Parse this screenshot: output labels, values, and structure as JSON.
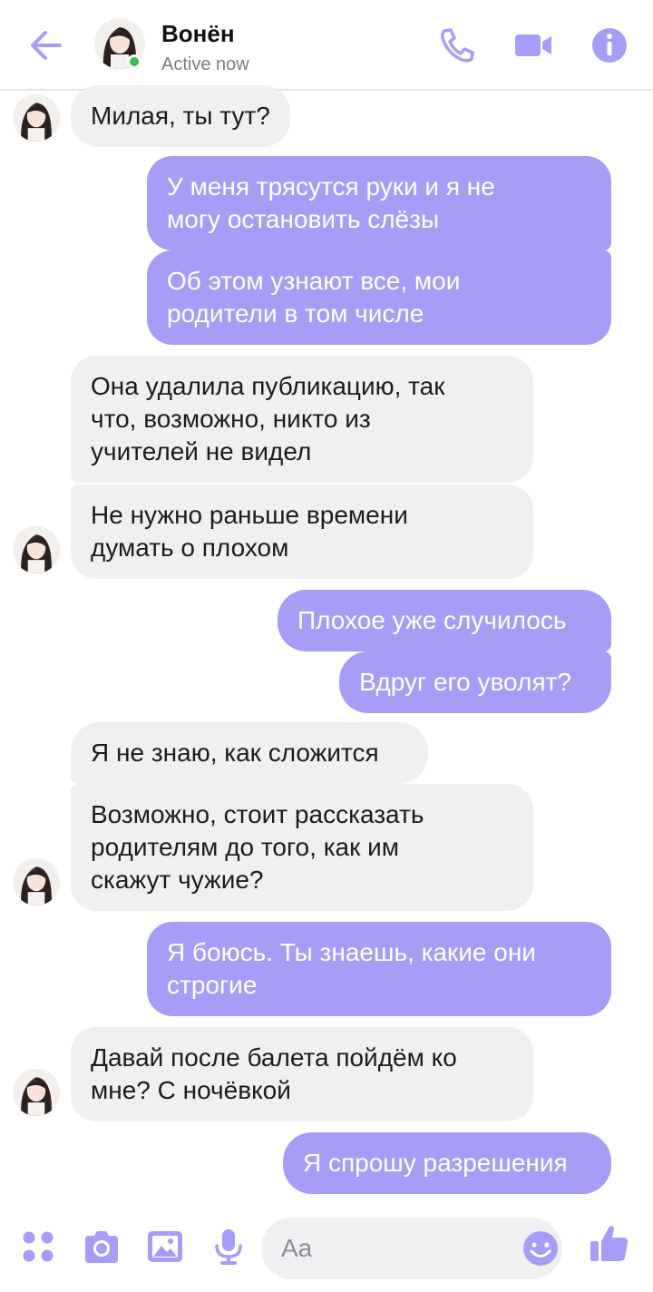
{
  "accent": "#a79df7",
  "header": {
    "name": "Вонён",
    "status": "Active now",
    "icons": [
      "back-arrow-icon",
      "phone-icon",
      "video-icon",
      "info-icon"
    ]
  },
  "messages": [
    {
      "dir": "in",
      "text": "Милая, ты тут?"
    },
    {
      "dir": "out",
      "text": "У меня трясутся руки и я не\nмогу остановить слёзы"
    },
    {
      "dir": "out",
      "text": "Об этом узнают все, мои\nродители в том числе"
    },
    {
      "dir": "in",
      "text": "Она удалила публикацию, так\nчто, возможно, никто из\nучителей не видел"
    },
    {
      "dir": "in",
      "text": "Не нужно раньше времени\nдумать о плохом"
    },
    {
      "dir": "out",
      "text": "Плохое уже случилось"
    },
    {
      "dir": "out",
      "text": "Вдруг его уволят?"
    },
    {
      "dir": "in",
      "text": "Я не знаю, как сложится"
    },
    {
      "dir": "in",
      "text": "Возможно, стоит рассказать\nродителям до того, как им\nскажут чужие?"
    },
    {
      "dir": "out",
      "text": "Я боюсь. Ты знаешь, какие они\nстрогие"
    },
    {
      "dir": "in",
      "text": "Давай после балета пойдём ко\nмне? С ночёвкой"
    },
    {
      "dir": "out",
      "text": "Я спрошу разрешения"
    }
  ],
  "composer": {
    "placeholder": "Aa",
    "icons": [
      "apps-icon",
      "camera-icon",
      "image-icon",
      "microphone-icon",
      "emoji-icon",
      "thumbs-up-icon"
    ]
  }
}
